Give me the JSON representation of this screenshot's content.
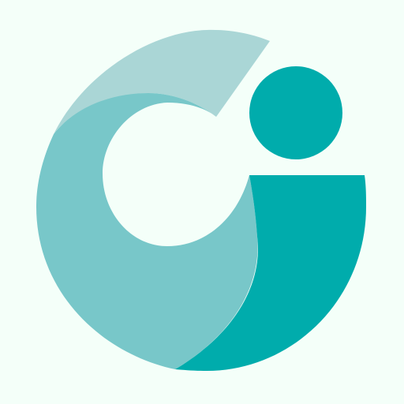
{
  "canvas": {
    "background": "#F4FFF9"
  },
  "logo": {
    "icon": "ci-letter-mark-icon",
    "colors": {
      "top_arc": "#AAD6D6",
      "left_body": "#78C7C9",
      "right_body": "#00ACAC",
      "dot": "#00ACAC"
    }
  }
}
